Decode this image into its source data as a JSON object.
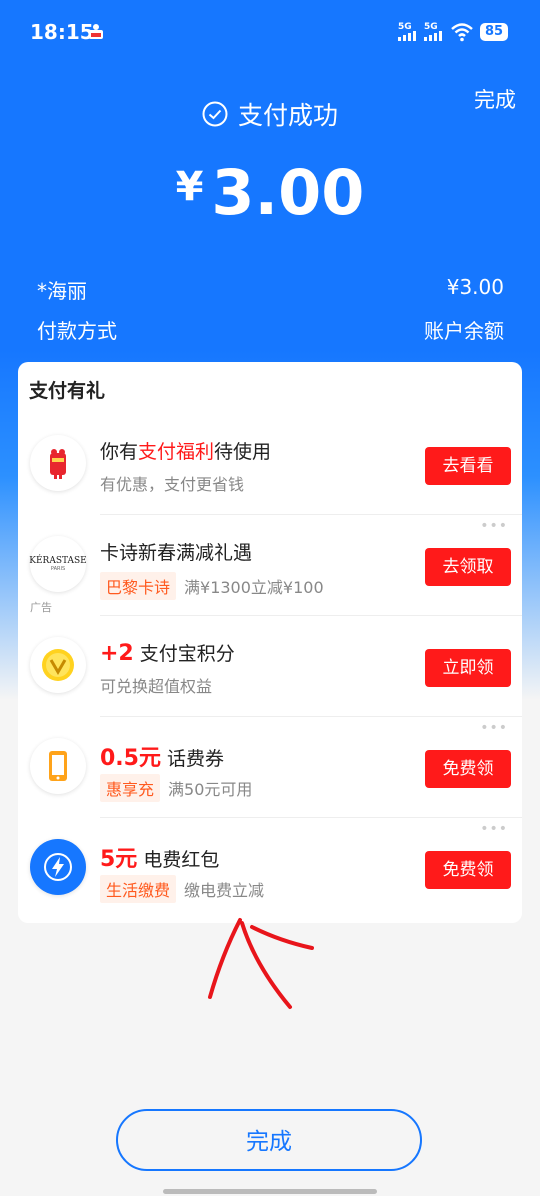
{
  "status_bar": {
    "time": "18:15",
    "sig1": "5G",
    "sig2": "5G",
    "battery": "85"
  },
  "header": {
    "done_label": "完成",
    "success_text": "支付成功",
    "currency": "¥",
    "amount": "3.00",
    "payee": "*海丽",
    "payee_amount": "¥3.00",
    "method_label": "付款方式",
    "method_value": "账户余额"
  },
  "card": {
    "title": "支付有礼",
    "items": [
      {
        "pre": "你有",
        "highlight": "支付福利",
        "post": "待使用",
        "sub": "有优惠，支付更省钱",
        "button": "去看看"
      },
      {
        "title": "卡诗新春满减礼遇",
        "tag": "巴黎卡诗",
        "sub": "满¥1300立减¥100",
        "button": "去领取",
        "logo_text": "KÉRASTASE",
        "logo_sub": "PARIS",
        "ad": "广告"
      },
      {
        "big": "+2",
        "title": " 支付宝积分",
        "sub": "可兑换超值权益",
        "button": "立即领"
      },
      {
        "big": "0.5元",
        "title": " 话费券",
        "tag": "惠享充",
        "sub": "满50元可用",
        "button": "免费领"
      },
      {
        "big": "5元",
        "title": " 电费红包",
        "tag": "生活缴费",
        "sub": "缴电费立减",
        "button": "免费领"
      }
    ],
    "dots": "•••"
  },
  "footer": {
    "done_label": "完成"
  },
  "colors": {
    "brand_blue": "#1677ff",
    "red": "#ff1a1a",
    "tag_orange": "#ff5a1f"
  }
}
